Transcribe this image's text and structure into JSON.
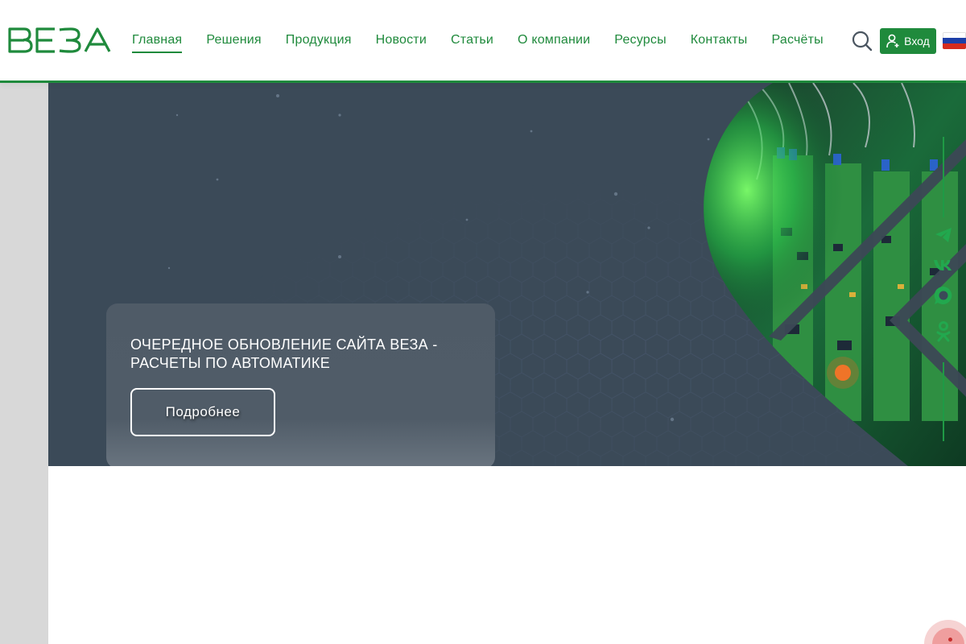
{
  "header": {
    "logo_text": "ВЕЗА",
    "nav": [
      {
        "label": "Главная",
        "active": true
      },
      {
        "label": "Решения"
      },
      {
        "label": "Продукция"
      },
      {
        "label": "Новости"
      },
      {
        "label": "Статьи"
      },
      {
        "label": "О компании"
      },
      {
        "label": "Ресурсы"
      },
      {
        "label": "Контакты"
      },
      {
        "label": "Расчёты"
      }
    ],
    "search_icon": "search-icon",
    "login_label": "Вход",
    "login_icon": "user-plus-icon",
    "language_flag": "russia-flag-icon"
  },
  "hero": {
    "slide_title": "ОЧЕРЕДНОЕ ОБНОВЛЕНИЕ САЙТА ВЕЗА - РАСЧЕТЫ ПО АВТОМАТИКЕ",
    "more_label": "Подробнее",
    "image": "electronics-circuit-boards-photo"
  },
  "social": [
    {
      "name": "telegram-icon"
    },
    {
      "name": "vk-icon"
    },
    {
      "name": "max-messenger-icon"
    },
    {
      "name": "odnoklassniki-icon"
    }
  ],
  "colors": {
    "brand_green": "#1f8a3c",
    "hero_bg": "#3b4a58",
    "card_bg": "#505c68",
    "gutter": "#d8d8d8"
  }
}
